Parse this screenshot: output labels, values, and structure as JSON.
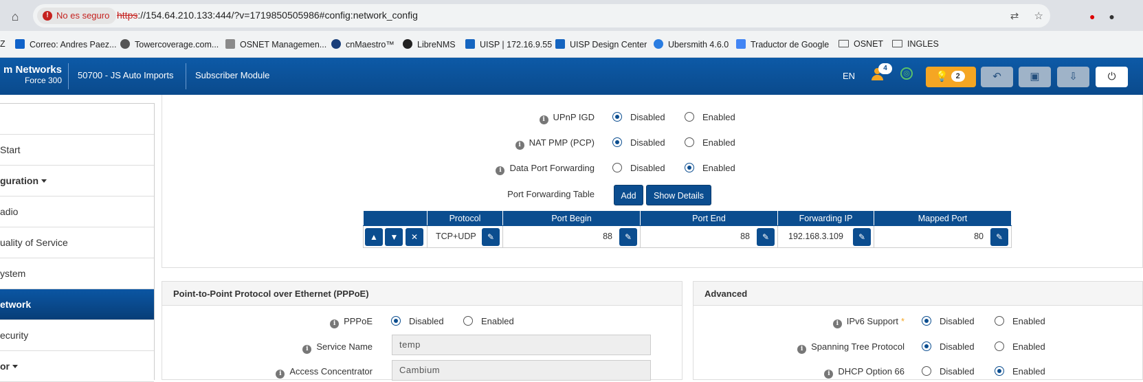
{
  "browser": {
    "insecure_label": "No es seguro",
    "url_scheme": "https",
    "url_rest": "://154.64.210.133:444/?v=1719850505986#config:network_config"
  },
  "bookmarks": [
    {
      "label": "Z"
    },
    {
      "label": "Correo: Andres Paez..."
    },
    {
      "label": "Towercoverage.com..."
    },
    {
      "label": "OSNET Managemen..."
    },
    {
      "label": "cnMaestro™"
    },
    {
      "label": "LibreNMS"
    },
    {
      "label": "UISP | 172.16.9.55"
    },
    {
      "label": "UISP Design Center"
    },
    {
      "label": "Ubersmith 4.6.0"
    },
    {
      "label": "Traductor de Google"
    },
    {
      "label": "OSNET"
    },
    {
      "label": "INGLES"
    }
  ],
  "header": {
    "brand_line1": "m Networks",
    "brand_line2": "Force 300",
    "device_name": "50700 - JS Auto Imports",
    "module": "Subscriber Module",
    "language": "EN",
    "user_count": "4",
    "alert_count": "2"
  },
  "sidebar": {
    "items": [
      {
        "label": "Start"
      },
      {
        "label": "guration"
      },
      {
        "label": "adio"
      },
      {
        "label": "uality of Service"
      },
      {
        "label": "ystem"
      },
      {
        "label": "etwork"
      },
      {
        "label": "ecurity"
      },
      {
        "label": "or"
      }
    ]
  },
  "nat": {
    "upnp_label": "UPnP IGD",
    "natpmp_label": "NAT PMP (PCP)",
    "dataport_label": "Data Port Forwarding",
    "disabled": "Disabled",
    "enabled": "Enabled",
    "table_label": "Port Forwarding Table",
    "add_label": "Add",
    "show_details_label": "Show Details"
  },
  "table": {
    "headers": [
      "Protocol",
      "Port Begin",
      "Port End",
      "Forwarding IP",
      "Mapped Port"
    ],
    "row": {
      "protocol": "TCP+UDP",
      "port_begin": "88",
      "port_end": "88",
      "forwarding_ip": "192.168.3.109",
      "mapped_port": "80"
    }
  },
  "pppoe": {
    "title": "Point-to-Point Protocol over Ethernet (PPPoE)",
    "pppoe_label": "PPPoE",
    "service_name_label": "Service Name",
    "service_name_value": "temp",
    "access_conc_label": "Access Concentrator",
    "access_conc_value": "Cambium"
  },
  "advanced": {
    "title": "Advanced",
    "ipv6_label": "IPv6 Support",
    "ipv6_req": "*",
    "stp_label": "Spanning Tree Protocol",
    "dhcp66_label": "DHCP Option 66"
  }
}
